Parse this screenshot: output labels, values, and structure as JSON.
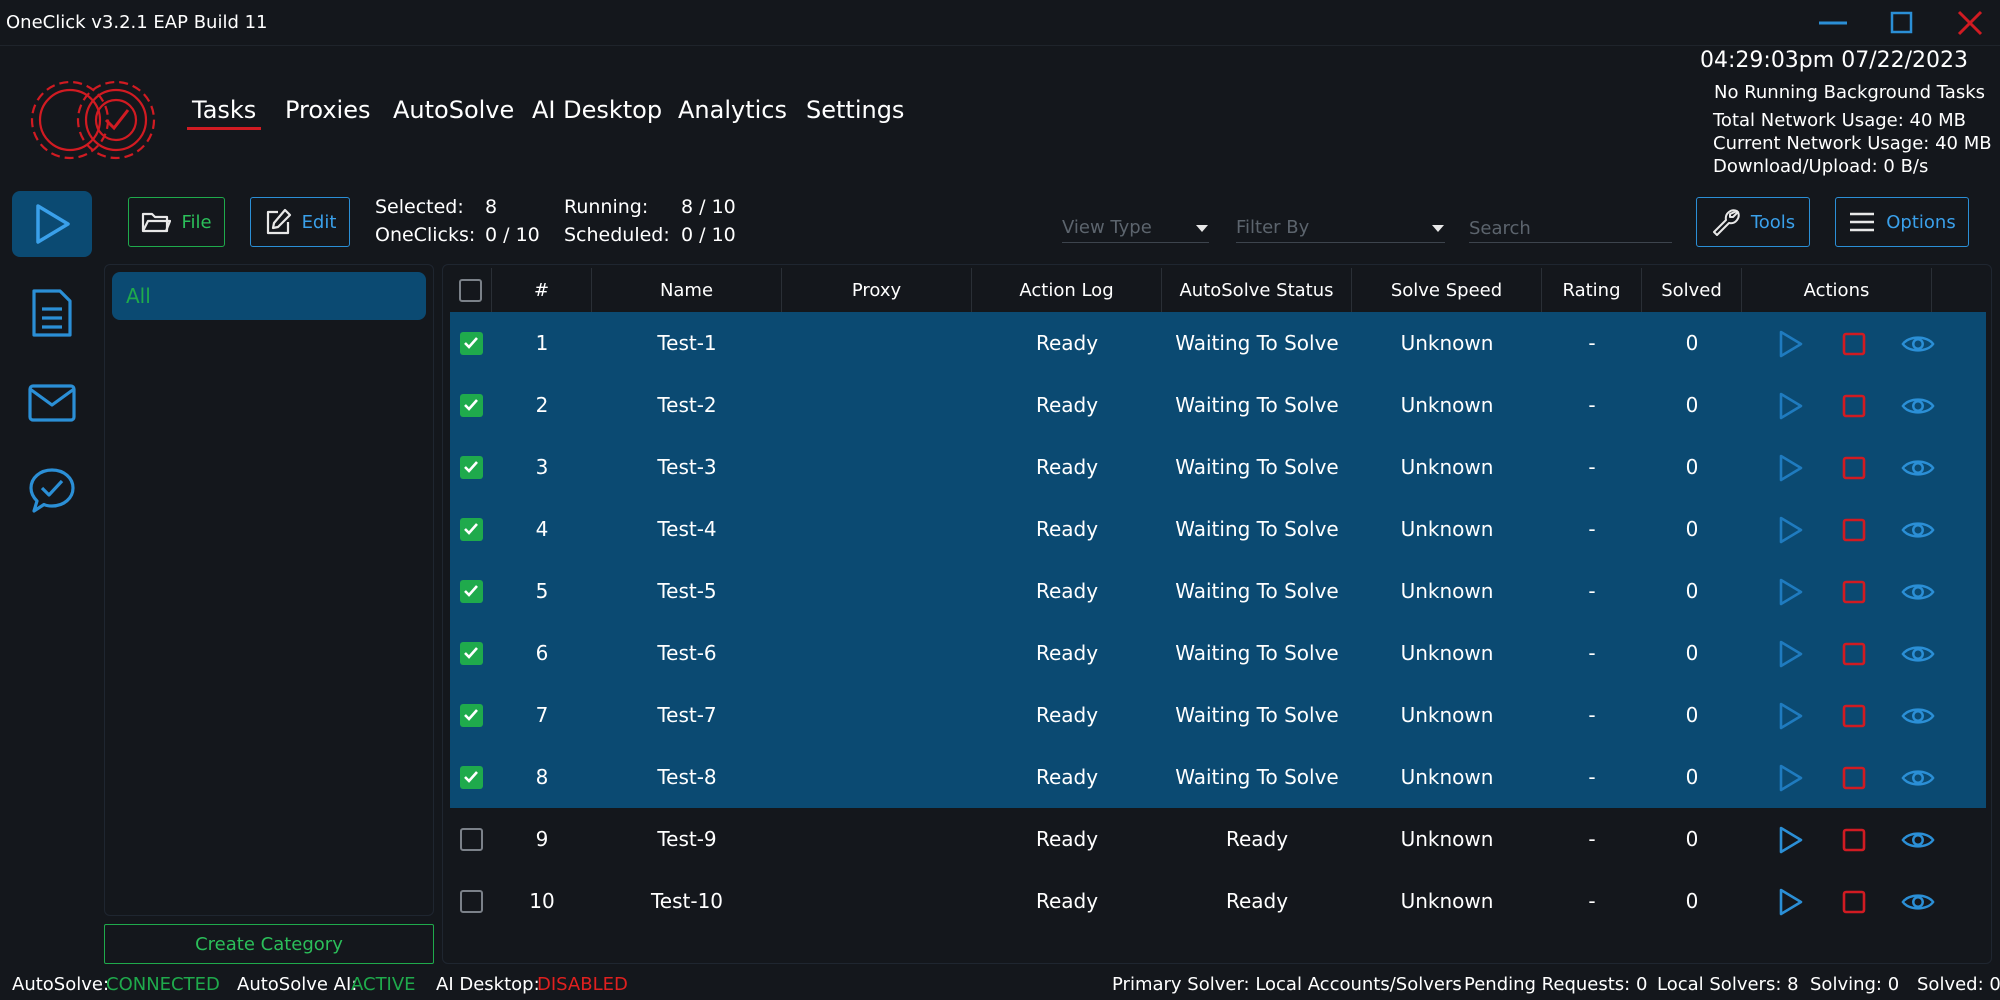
{
  "window": {
    "title": "OneClick v3.2.1 EAP Build 11",
    "colors": {
      "minimize": "#2b8fd6",
      "maximize": "#2b8fd6",
      "close": "#d11b22"
    }
  },
  "nav": {
    "tabs": [
      "Tasks",
      "Proxies",
      "AutoSolve",
      "AI Desktop",
      "Analytics",
      "Settings"
    ],
    "active": "Tasks"
  },
  "header_info": {
    "datetime": "04:29:03pm 07/22/2023",
    "background_tasks": "No Running Background Tasks",
    "total_network": "Total Network Usage:  40 MB",
    "current_network": "Current Network Usage: 40 MB",
    "download_upload": "Download/Upload: 0 B/s"
  },
  "sidebar": {
    "items": [
      {
        "icon": "play-icon",
        "active": true
      },
      {
        "icon": "document-icon",
        "active": false
      },
      {
        "icon": "mail-icon",
        "active": false
      },
      {
        "icon": "chat-check-icon",
        "active": false
      }
    ]
  },
  "toolbar": {
    "file_label": "File",
    "edit_label": "Edit",
    "selected_label": "Selected:",
    "selected_value": "8",
    "oneclicks_label": "OneClicks:",
    "oneclicks_value": "0 / 10",
    "running_label": "Running:",
    "running_value": "8 / 10",
    "scheduled_label": "Scheduled:",
    "scheduled_value": "0 / 10",
    "view_type_placeholder": "View Type",
    "filter_by_placeholder": "Filter By",
    "search_placeholder": "Search",
    "tools_label": "Tools",
    "options_label": "Options"
  },
  "categories": {
    "items": [
      "All"
    ],
    "create_label": "Create Category"
  },
  "table": {
    "headers": [
      "#",
      "Name",
      "Proxy",
      "Action Log",
      "AutoSolve Status",
      "Solve Speed",
      "Rating",
      "Solved",
      "Actions"
    ],
    "rows": [
      {
        "checked": true,
        "num": "1",
        "name": "Test-1",
        "proxy": "",
        "action_log": "Ready",
        "autosolve_status": "Waiting To Solve",
        "solve_speed": "Unknown",
        "rating": "-",
        "solved": "0"
      },
      {
        "checked": true,
        "num": "2",
        "name": "Test-2",
        "proxy": "",
        "action_log": "Ready",
        "autosolve_status": "Waiting To Solve",
        "solve_speed": "Unknown",
        "rating": "-",
        "solved": "0"
      },
      {
        "checked": true,
        "num": "3",
        "name": "Test-3",
        "proxy": "",
        "action_log": "Ready",
        "autosolve_status": "Waiting To Solve",
        "solve_speed": "Unknown",
        "rating": "-",
        "solved": "0"
      },
      {
        "checked": true,
        "num": "4",
        "name": "Test-4",
        "proxy": "",
        "action_log": "Ready",
        "autosolve_status": "Waiting To Solve",
        "solve_speed": "Unknown",
        "rating": "-",
        "solved": "0"
      },
      {
        "checked": true,
        "num": "5",
        "name": "Test-5",
        "proxy": "",
        "action_log": "Ready",
        "autosolve_status": "Waiting To Solve",
        "solve_speed": "Unknown",
        "rating": "-",
        "solved": "0"
      },
      {
        "checked": true,
        "num": "6",
        "name": "Test-6",
        "proxy": "",
        "action_log": "Ready",
        "autosolve_status": "Waiting To Solve",
        "solve_speed": "Unknown",
        "rating": "-",
        "solved": "0"
      },
      {
        "checked": true,
        "num": "7",
        "name": "Test-7",
        "proxy": "",
        "action_log": "Ready",
        "autosolve_status": "Waiting To Solve",
        "solve_speed": "Unknown",
        "rating": "-",
        "solved": "0"
      },
      {
        "checked": true,
        "num": "8",
        "name": "Test-8",
        "proxy": "",
        "action_log": "Ready",
        "autosolve_status": "Waiting To Solve",
        "solve_speed": "Unknown",
        "rating": "-",
        "solved": "0"
      },
      {
        "checked": false,
        "num": "9",
        "name": "Test-9",
        "proxy": "",
        "action_log": "Ready",
        "autosolve_status": "Ready",
        "solve_speed": "Unknown",
        "rating": "-",
        "solved": "0"
      },
      {
        "checked": false,
        "num": "10",
        "name": "Test-10",
        "proxy": "",
        "action_log": "Ready",
        "autosolve_status": "Ready",
        "solve_speed": "Unknown",
        "rating": "-",
        "solved": "0"
      }
    ],
    "action_icons": [
      "play-icon",
      "stop-icon",
      "eye-icon"
    ]
  },
  "statusbar": {
    "autosolve_label": "AutoSolve:",
    "autosolve_value": "CONNECTED",
    "autosolve_ai_label": "AutoSolve AI:",
    "autosolve_ai_value": "ACTIVE",
    "ai_desktop_label": "AI Desktop:",
    "ai_desktop_value": "DISABLED",
    "primary_solver": "Primary Solver: Local Accounts/Solvers",
    "pending_requests": "Pending Requests: 0",
    "local_solvers": "Local Solvers: 8",
    "solving": "Solving: 0",
    "solved": "Solved: 0",
    "colors": {
      "connected": "#1faa4c",
      "active": "#1faa4c",
      "disabled": "#e0201f"
    }
  },
  "colors": {
    "background": "#14171c",
    "accent_blue": "#2b8fd6",
    "selected_row": "#0b4a72",
    "green": "#1faa4c",
    "red": "#d11b22"
  }
}
